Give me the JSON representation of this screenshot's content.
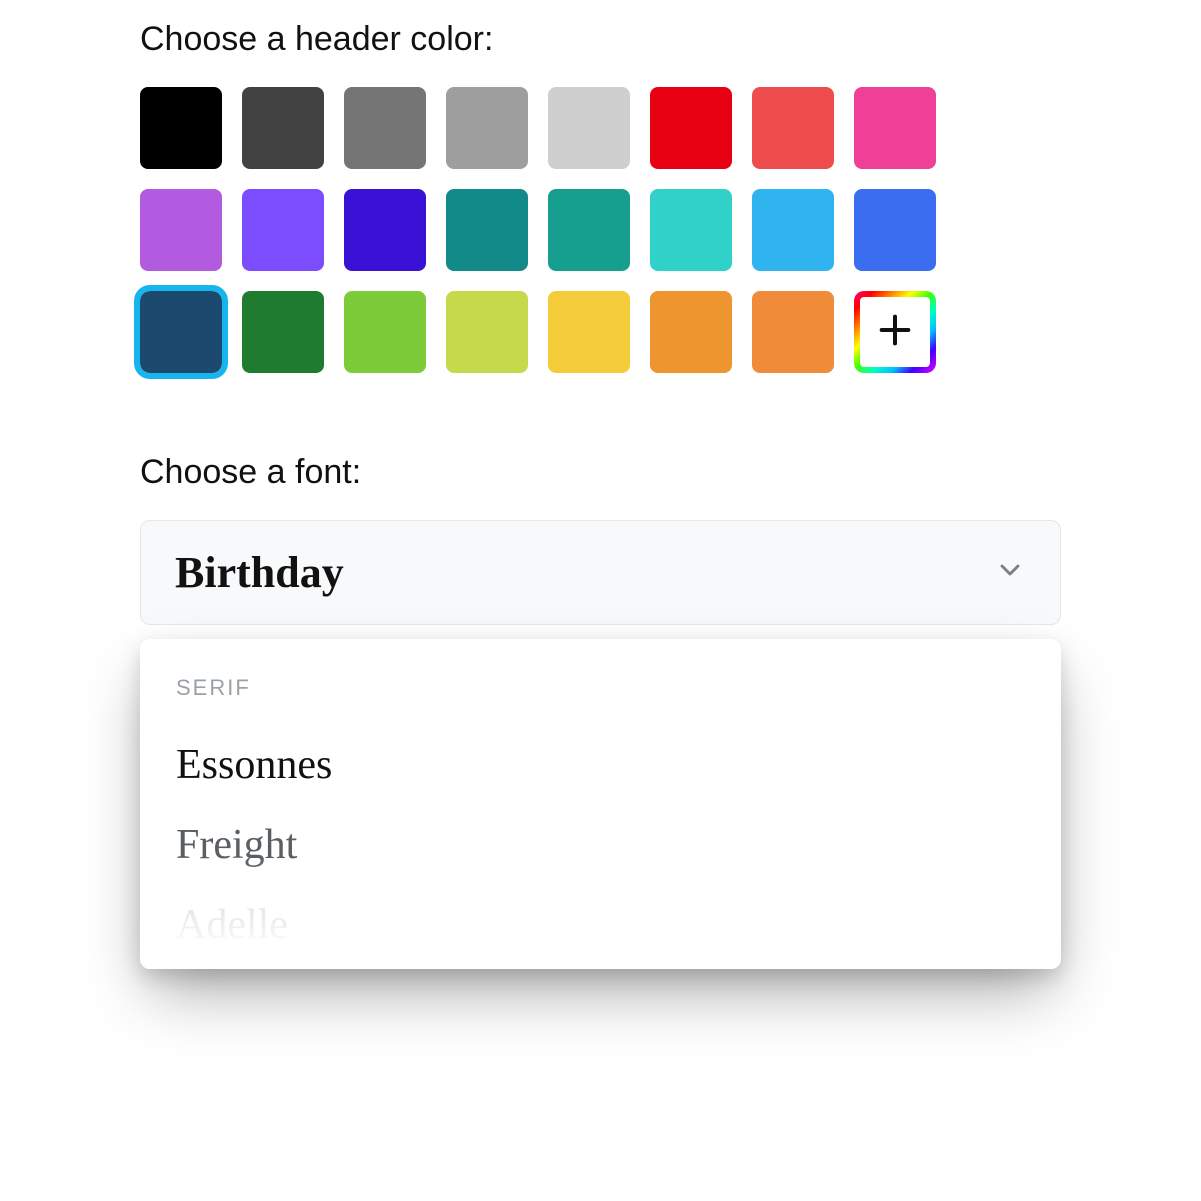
{
  "header_color": {
    "label": "Choose a header color:",
    "selected_index": 16,
    "colors": [
      "#000000",
      "#424242",
      "#757575",
      "#9e9e9e",
      "#cfcfcf",
      "#e60012",
      "#ef4d4d",
      "#ef3f97",
      "#b25be0",
      "#7c4dff",
      "#3a12d6",
      "#128a8a",
      "#169e8f",
      "#2fd1c9",
      "#2fb4f0",
      "#3a6df0",
      "#1c4a6e",
      "#1e7b2f",
      "#7ecb3a",
      "#c6d94a",
      "#f4cc3a",
      "#ef9530",
      "#f08b3a"
    ],
    "custom_label": "Custom color"
  },
  "font": {
    "label": "Choose a font:",
    "selected": "Birthday",
    "group_label": "SERIF",
    "options": [
      "Essonnes",
      "Freight",
      "Adelle"
    ]
  }
}
